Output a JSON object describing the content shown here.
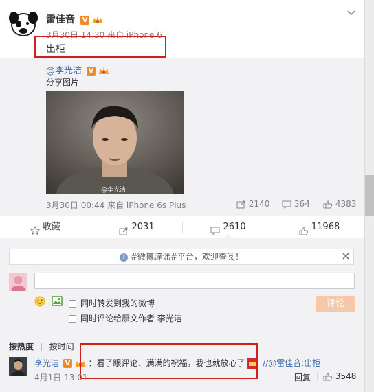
{
  "post": {
    "author": "雷佳音",
    "timestamp": "3月30日 14:30 来自 iPhone 6",
    "text": "出柜"
  },
  "repost": {
    "author": "@李光洁",
    "text": "分享图片",
    "watermark": "@李光洁",
    "timestamp": "3月30日 00:44 来自 iPhone 6s Plus",
    "share_count": "2140",
    "comment_count": "364",
    "like_count": "4383"
  },
  "actions": {
    "favorite": "收藏",
    "share": "2031",
    "comment": "2610",
    "like": "11968"
  },
  "comment_box": {
    "notice": "#微博辟谣#平台，欢迎查阅！",
    "option_forward": "同时转发到我的微博",
    "option_comment_author": "同时评论给原文作者 李光洁",
    "submit": "评论"
  },
  "sort": {
    "by_hot": "按热度",
    "by_time": "按时间"
  },
  "comments": [
    {
      "author": "李光洁",
      "text": "：看了眼评论、满满的祝福，我也就放心了",
      "quote": "//@雷佳音:出柜",
      "timestamp": "4月1日 13:01",
      "reply": "回复",
      "likes": "3548"
    }
  ],
  "colors": {
    "accent": "#eb7350",
    "link": "#3a6ab3",
    "highlight_box": "#d21e1e"
  }
}
